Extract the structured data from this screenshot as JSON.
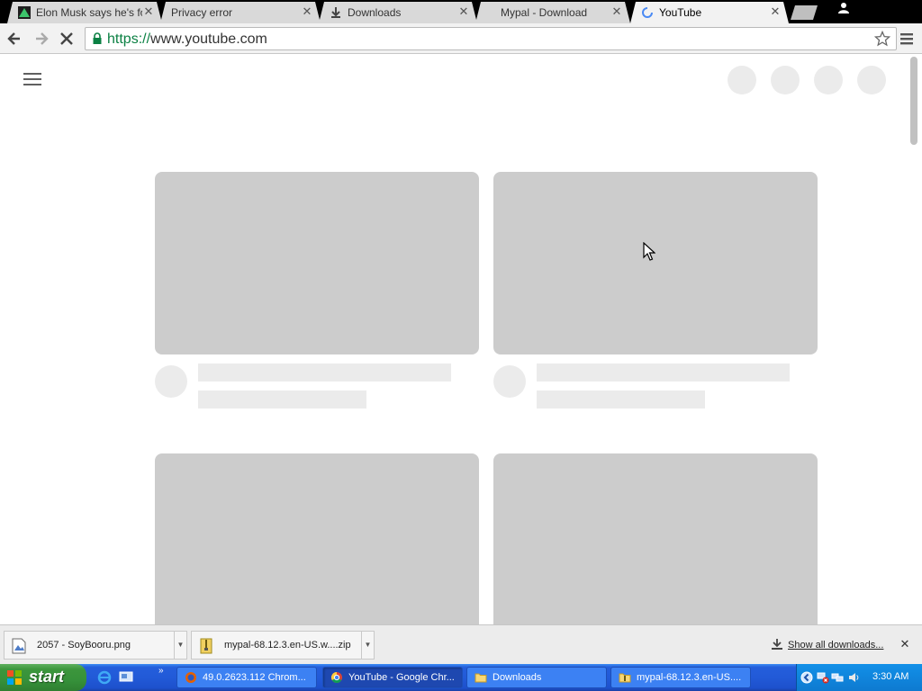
{
  "browser": {
    "tabs": [
      {
        "title": "Elon Musk says he's fou",
        "close": "✕",
        "favicon": "green-triangle-icon"
      },
      {
        "title": "Privacy error",
        "close": "✕"
      },
      {
        "title": "Downloads",
        "close": "✕",
        "favicon": "download-icon"
      },
      {
        "title": "Mypal - Download",
        "close": "✕"
      },
      {
        "title": "YouTube",
        "close": "✕",
        "favicon": "loading-spinner-icon",
        "active": true
      }
    ],
    "url_scheme": "https://",
    "url_host": "www.youtube.com"
  },
  "page": {
    "state": "loading-skeleton"
  },
  "downloads": {
    "items": [
      {
        "name": "2057 - SoyBooru.png",
        "icon": "image-file-icon"
      },
      {
        "name": "mypal-68.12.3.en-US.w....zip",
        "icon": "zip-file-icon"
      }
    ],
    "show_all": "Show all downloads...",
    "close": "✕"
  },
  "taskbar": {
    "start_label": "start",
    "quicklaunch_more": "»",
    "tasks": [
      {
        "label": "49.0.2623.112 Chrom...",
        "icon": "firefox-icon"
      },
      {
        "label": "YouTube - Google Chr...",
        "icon": "chrome-icon",
        "active": true
      },
      {
        "label": "Downloads",
        "icon": "folder-icon"
      },
      {
        "label": "mypal-68.12.3.en-US....",
        "icon": "zip-folder-icon"
      }
    ],
    "clock": "3:30 AM"
  },
  "colors": {
    "skeleton_dark": "#cccccc",
    "skeleton_light": "#ebebeb",
    "secure_green": "#0b8043",
    "xp_blue": "#245edb",
    "xp_green": "#3c963c"
  }
}
